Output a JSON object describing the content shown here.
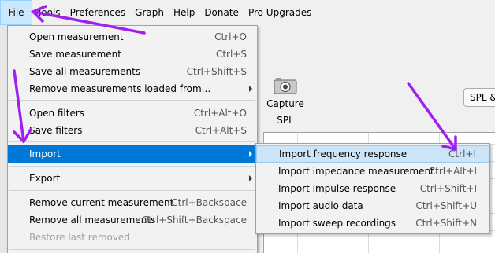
{
  "menubar": {
    "items": [
      "File",
      "Tools",
      "Preferences",
      "Graph",
      "Help",
      "Donate",
      "Pro Upgrades"
    ]
  },
  "toolbar": {
    "capture_label": "Capture",
    "spl_label": "SPL",
    "spl_button_label": "SPL &"
  },
  "file_menu": {
    "items": [
      {
        "label": "Open measurement",
        "shortcut": "Ctrl+O"
      },
      {
        "label": "Save measurement",
        "shortcut": "Ctrl+S"
      },
      {
        "label": "Save all measurements",
        "shortcut": "Ctrl+Shift+S"
      },
      {
        "label": "Remove measurements loaded from...",
        "shortcut": ""
      },
      {
        "label": "Open filters",
        "shortcut": "Ctrl+Alt+O"
      },
      {
        "label": "Save filters",
        "shortcut": "Ctrl+Alt+S"
      },
      {
        "label": "Import",
        "shortcut": ""
      },
      {
        "label": "Export",
        "shortcut": ""
      },
      {
        "label": "Remove current measurement",
        "shortcut": "Ctrl+Backspace"
      },
      {
        "label": "Remove all measurements",
        "shortcut": "Ctrl+Shift+Backspace"
      },
      {
        "label": "Restore last removed",
        "shortcut": ""
      }
    ]
  },
  "import_menu": {
    "items": [
      {
        "label": "Import frequency response",
        "shortcut": "Ctrl+I"
      },
      {
        "label": "Import impedance measurement",
        "shortcut": "Ctrl+Alt+I"
      },
      {
        "label": "Import impulse response",
        "shortcut": "Ctrl+Shift+I"
      },
      {
        "label": "Import audio data",
        "shortcut": "Ctrl+Shift+U"
      },
      {
        "label": "Import sweep recordings",
        "shortcut": "Ctrl+Shift+N"
      }
    ]
  },
  "colors": {
    "selection": "#0078d7",
    "hover": "#cce4f7",
    "annotation_arrow": "#a020f0"
  }
}
